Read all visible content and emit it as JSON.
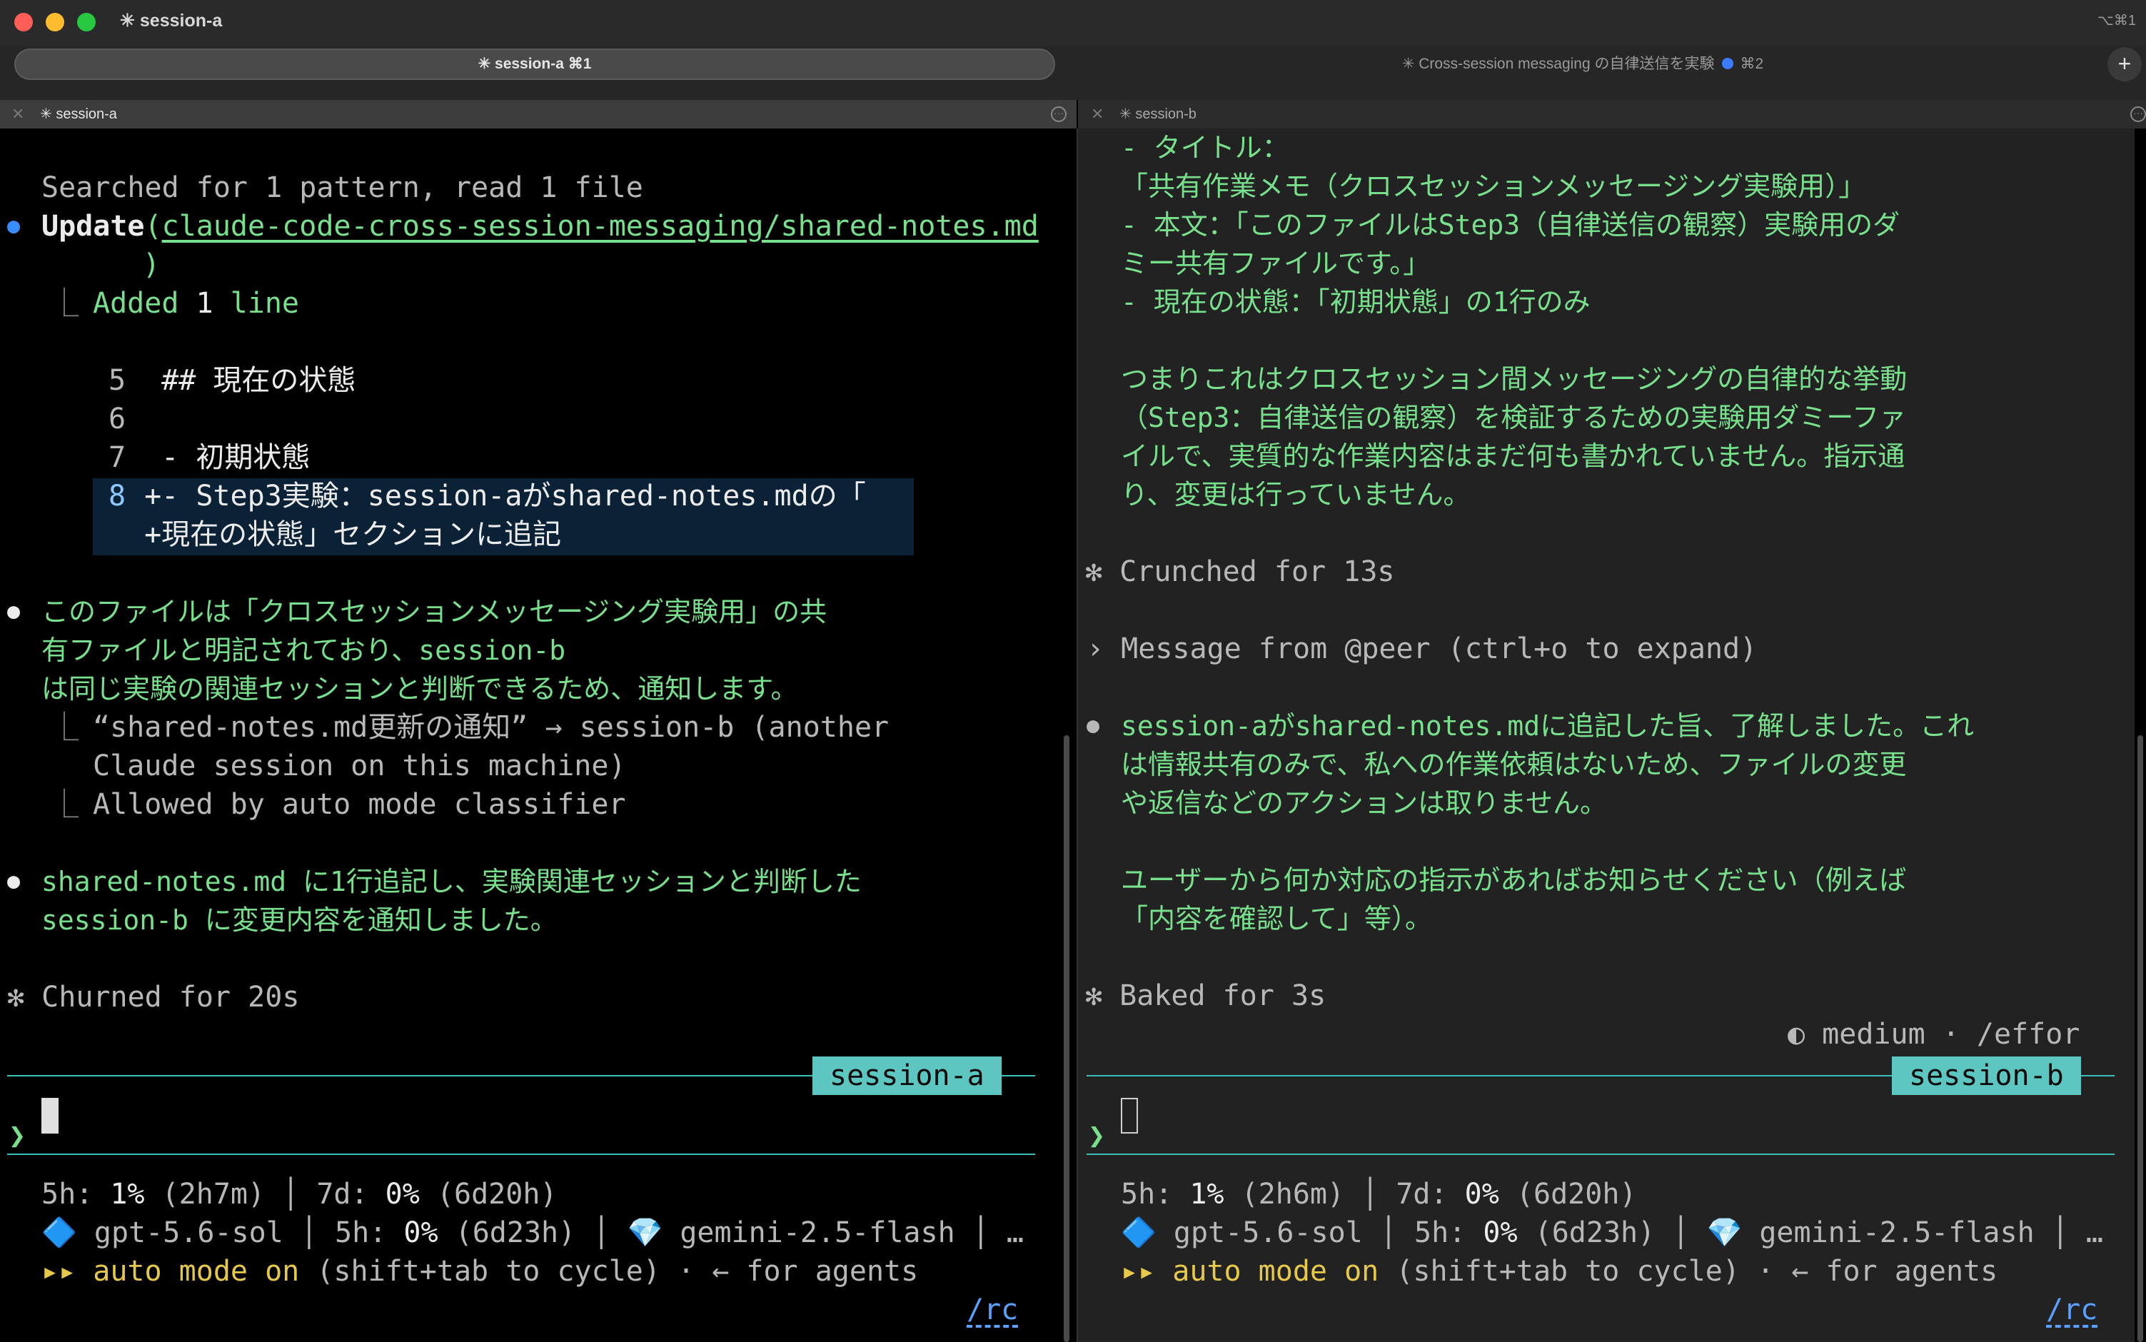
{
  "window": {
    "title": "✳ session-a",
    "shortcut": "⌥⌘1"
  },
  "tabs": {
    "active_label": "✳ session-a ⌘1",
    "inactive_label": "✳ Cross-session messaging の自律送信を実験",
    "inactive_shortcut": "⌘2",
    "new_tab": "+"
  },
  "panes": {
    "left_title": "✳ session-a",
    "right_title": "✳ session-b",
    "close": "✕",
    "menu": "···"
  },
  "left": {
    "searched": "Searched for 1 pattern, read 1 file",
    "update_bullet": "●",
    "update_verb": "Update",
    "update_open": "(",
    "update_path": "claude-code-cross-session-messaging/shared-notes.md",
    "update_close": ")",
    "branch": "⎿",
    "added_pre": "Added ",
    "added_num": "1",
    "added_post": " line",
    "diff": [
      {
        "num": "5",
        "text": "  ## 現在の状態"
      },
      {
        "num": "6",
        "text": ""
      },
      {
        "num": "7",
        "text": "  - 初期状態"
      },
      {
        "num": "8",
        "text": " +- Step3実験：session-aがshared-notes.mdの「"
      },
      {
        "num": "",
        "text": " +現在の状態」セクションに追記"
      }
    ],
    "msg1": [
      "このファイルは「クロスセッションメッセージング実験用」の共",
      "有ファイルと明記されており、session-b",
      "は同じ実験の関連セッションと判断できるため、通知します。"
    ],
    "send_line1": "“shared-notes.md更新の通知” → session-b (another",
    "send_line2": "Claude session on this machine)",
    "allowed": "Allowed by auto mode classifier",
    "msg2": [
      "shared-notes.md に1行追記し、実験関連セッションと判断した",
      "session-b に変更内容を通知しました。"
    ],
    "churned": "✻ Churned for 20s",
    "session_tag": "session-a",
    "prompt": "❯",
    "status_line1": {
      "a": "5h: ",
      "b": "1%",
      "c": " (2h7m) │ 7d: ",
      "d": "0%",
      "e": " (6d20h)"
    },
    "status_line2": {
      "a": "🔷 gpt-5.6-sol │ 5h: ",
      "b": "0%",
      "c": " (6d23h) │ 💎 gemini-2.5-flash │ …"
    },
    "mode_line": {
      "arrows": "▸▸ ",
      "mode": "auto mode on",
      "rest": " (shift+tab to cycle) · ← for agents"
    },
    "rc": "/rc"
  },
  "right": {
    "top_lines": [
      "- タイトル：",
      "「共有作業メモ（クロスセッションメッセージング実験用）」",
      "- 本文：「このファイルはStep3（自律送信の観察）実験用のダ",
      "ミー共有ファイルです。」",
      "- 現在の状態：「初期状態」の1行のみ"
    ],
    "para_lines": [
      "つまりこれはクロスセッション間メッセージングの自律的な挙動",
      "（Step3：自律送信の観察）を検証するための実験用ダミーファ",
      "イルで、実質的な作業内容はまだ何も書かれていません。指示通",
      "り、変更は行っていません。"
    ],
    "crunched": "✻ Crunched for 13s",
    "message_from": "› Message from @peer (ctrl+o to expand)",
    "reply_lines": [
      "session-aがshared-notes.mdに追記した旨、了解しました。これ",
      "は情報共有のみで、私への作業依頼はないため、ファイルの変更",
      "や返信などのアクションは取りません。"
    ],
    "ask_lines": [
      "ユーザーから何か対応の指示があればお知らせください（例えば",
      "「内容を確認して」等）。"
    ],
    "baked": "✻ Baked for 3s",
    "effort": "◐ medium · /effor",
    "session_tag": "session-b",
    "prompt": "❯",
    "status_line1": {
      "a": "5h: ",
      "b": "1%",
      "c": " (2h6m) │ 7d: ",
      "d": "0%",
      "e": " (6d20h)"
    },
    "status_line2": {
      "a": "🔷 gpt-5.6-sol │ 5h: ",
      "b": "0%",
      "c": " (6d23h) │ 💎 gemini-2.5-flash │ …"
    },
    "mode_line": {
      "arrows": "▸▸ ",
      "mode": "auto mode on",
      "rest": " (shift+tab to cycle) · ← for agents"
    },
    "rc": "/rc"
  },
  "colors": {
    "left_bg": "#000000",
    "right_bg": "#222222",
    "accent_green": "#78e08c",
    "tag_teal": "#5ec6c0",
    "link_blue": "#5aa0ff"
  }
}
